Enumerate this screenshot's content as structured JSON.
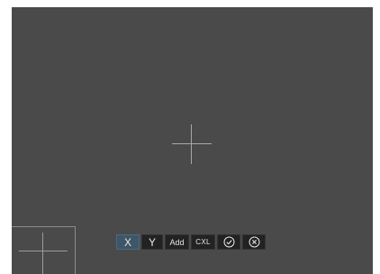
{
  "toolbar": {
    "x_label": "X",
    "y_label": "Y",
    "add_label": "Add",
    "cancel_label": "CXL",
    "confirm_icon": "check-circle-icon",
    "close_icon": "x-circle-icon"
  },
  "colors": {
    "canvas": "#4a4a4a",
    "button_bg": "#222222",
    "button_active_bg": "#3d5668",
    "button_text": "#e6e6e6",
    "crosshair": "#a8a8a8"
  }
}
